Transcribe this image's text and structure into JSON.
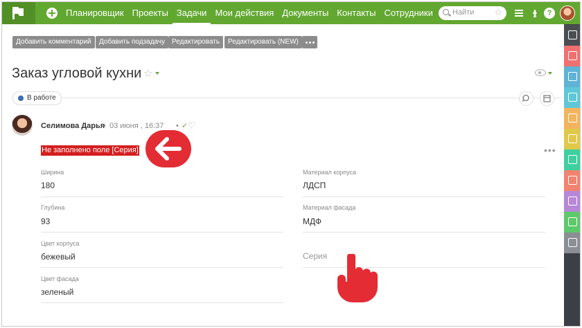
{
  "nav": {
    "items": [
      "Планировщик",
      "Проекты",
      "Задачи",
      "Мои действия",
      "Документы",
      "Контакты",
      "Сотрудники"
    ],
    "active_index": 2,
    "search_placeholder": "Найти",
    "help_label": "?"
  },
  "toolbar": {
    "buttons": [
      "Добавить комментарий",
      "Добавить подзадачу",
      "Редактировать",
      "Редактировать (NEW)"
    ]
  },
  "task": {
    "title": "Заказ угловой кухни",
    "status": "В работе"
  },
  "comment": {
    "author": "Селимова Дарья",
    "date": "03 июня , 16:37",
    "separator": "•",
    "error_text": "Не заполнено поле [Серия]"
  },
  "fields": {
    "left": [
      {
        "label": "Ширина",
        "value": "180"
      },
      {
        "label": "Глубина",
        "value": "93"
      },
      {
        "label": "Цвет корпуса",
        "value": "бежевый"
      },
      {
        "label": "Цвет фасада",
        "value": "зеленый"
      }
    ],
    "right": [
      {
        "label": "Материал корпуса",
        "value": "ЛДСП"
      },
      {
        "label": "Материал фасада",
        "value": "МДФ"
      },
      {
        "label": "",
        "value": "Серия"
      }
    ]
  },
  "colors": {
    "nav_bg": "#62a830",
    "error_bg": "#d41e1e",
    "annotation_red": "#e42c34",
    "status_dot": "#3a6fb8",
    "sidebar": [
      "#4a4d52",
      "#f07070",
      "#5fb3d6",
      "#5fc7d8",
      "#f4b45e",
      "#e0c94a",
      "#3fcfa0",
      "#f08470",
      "#b788d8",
      "#5ec96a",
      "#8b8e94"
    ]
  },
  "icons": {
    "sidebar": [
      "edit-list-icon",
      "list-icon",
      "org-chart-icon",
      "documents-icon",
      "bell-icon",
      "clipboard-icon",
      "search-person-icon",
      "contact-card-icon",
      "inbox-icon",
      "chat-icon",
      "pulse-icon"
    ]
  }
}
